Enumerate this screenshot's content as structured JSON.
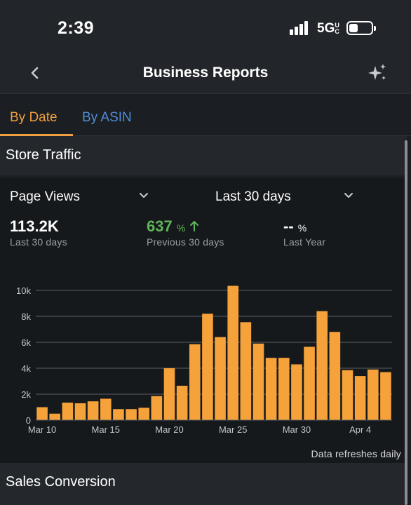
{
  "status_bar": {
    "time": "2:39",
    "network": "5G",
    "network_suffix": "UC"
  },
  "nav": {
    "title": "Business Reports"
  },
  "tabs": [
    {
      "label": "By Date"
    },
    {
      "label": "By ASIN"
    }
  ],
  "sections": {
    "store_traffic": "Store Traffic",
    "sales_conversion": "Sales Conversion"
  },
  "filters": {
    "metric": "Page Views",
    "range": "Last 30 days"
  },
  "metrics": {
    "current": {
      "value": "113.2K",
      "label": "Last 30 days"
    },
    "previous": {
      "value": "637",
      "unit": "%",
      "label": "Previous 30 days"
    },
    "last_year": {
      "value": "--",
      "unit": "%",
      "label": "Last Year"
    }
  },
  "footer_note": "Data refreshes daily",
  "colors": {
    "accent": "#f0a040",
    "link": "#4f8ed8",
    "positive": "#5fb55b",
    "bar": "#f5a23a"
  },
  "chart_data": {
    "type": "bar",
    "title": "",
    "xlabel": "",
    "ylabel": "",
    "ylim": [
      0,
      10000
    ],
    "y_ticks": [
      0,
      2000,
      4000,
      6000,
      8000,
      10000
    ],
    "y_tick_labels": [
      "0",
      "2k",
      "4k",
      "6k",
      "8k",
      "10k"
    ],
    "x_tick_labels": [
      {
        "index": 0,
        "label": "Mar 10"
      },
      {
        "index": 5,
        "label": "Mar 15"
      },
      {
        "index": 10,
        "label": "Mar 20"
      },
      {
        "index": 15,
        "label": "Mar 25"
      },
      {
        "index": 20,
        "label": "Mar 30"
      },
      {
        "index": 25,
        "label": "Apr 4"
      }
    ],
    "categories": [
      "Mar 10",
      "Mar 11",
      "Mar 12",
      "Mar 13",
      "Mar 14",
      "Mar 15",
      "Mar 16",
      "Mar 17",
      "Mar 18",
      "Mar 19",
      "Mar 20",
      "Mar 21",
      "Mar 22",
      "Mar 23",
      "Mar 24",
      "Mar 25",
      "Mar 26",
      "Mar 27",
      "Mar 28",
      "Mar 29",
      "Mar 30",
      "Mar 31",
      "Apr 1",
      "Apr 2",
      "Apr 3",
      "Apr 4",
      "Apr 5",
      "Apr 6"
    ],
    "values": [
      1000,
      500,
      1350,
      1300,
      1450,
      1650,
      850,
      850,
      950,
      1850,
      4000,
      2650,
      5850,
      8200,
      6400,
      10350,
      7550,
      5900,
      4800,
      4800,
      4300,
      5650,
      8400,
      6800,
      3850,
      3400,
      3900,
      3700
    ],
    "grid": true,
    "legend": "none"
  }
}
